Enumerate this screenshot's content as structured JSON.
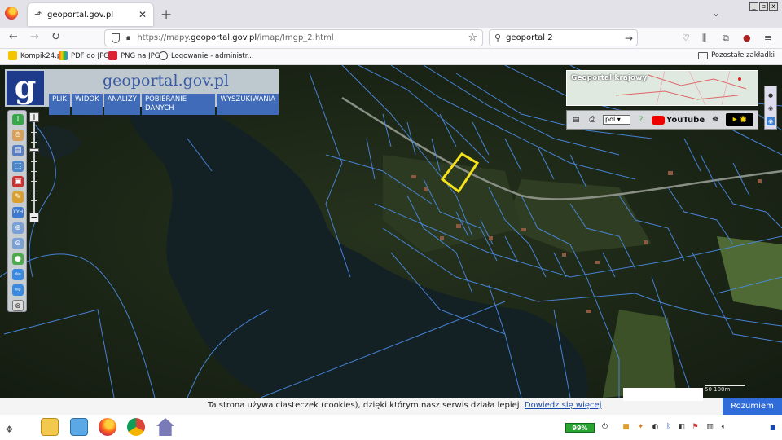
{
  "browser": {
    "tab_title": "geoportal.gov.pl",
    "new_tab": "+",
    "url_prefix": "https://mapy.",
    "url_domain": "geoportal.gov.pl",
    "url_path": "/imap/Imgp_2.html",
    "search_query": "geoportal 2",
    "bookmarks": [
      "Kompik24.pl",
      "PDF do JPG",
      "PNG na JPG",
      "Logowanie - administr..."
    ],
    "other_bookmarks": "Pozostałe zakładki"
  },
  "geoportal": {
    "logo_letter": "g",
    "site_title": "geoportal.gov.pl",
    "menu": [
      "PLIK",
      "WIDOK",
      "ANALIZY",
      "POBIERANIE DANYCH",
      "WYSZUKIWANIA"
    ],
    "overview_title": "Geoportal krajowy",
    "language": "pol",
    "youtube": "YouTube",
    "zoom_in": "+",
    "zoom_out": "−",
    "scale_label": "50  100m"
  },
  "cookie": {
    "message": "Ta strona używa ciasteczek (cookies), dzięki którym nasz serwis działa lepiej.",
    "link": "Dowiedz się więcej",
    "accept": "Rozumiem"
  },
  "taskbar": {
    "battery": "99%"
  },
  "colors": {
    "parcel_lines": "#4a8ce8",
    "selection": "#f5e21a",
    "lake": "#142226",
    "forest": "#1c2a18",
    "menu_blue": "#3f6bb8",
    "accept_button": "#2f6bd9"
  }
}
